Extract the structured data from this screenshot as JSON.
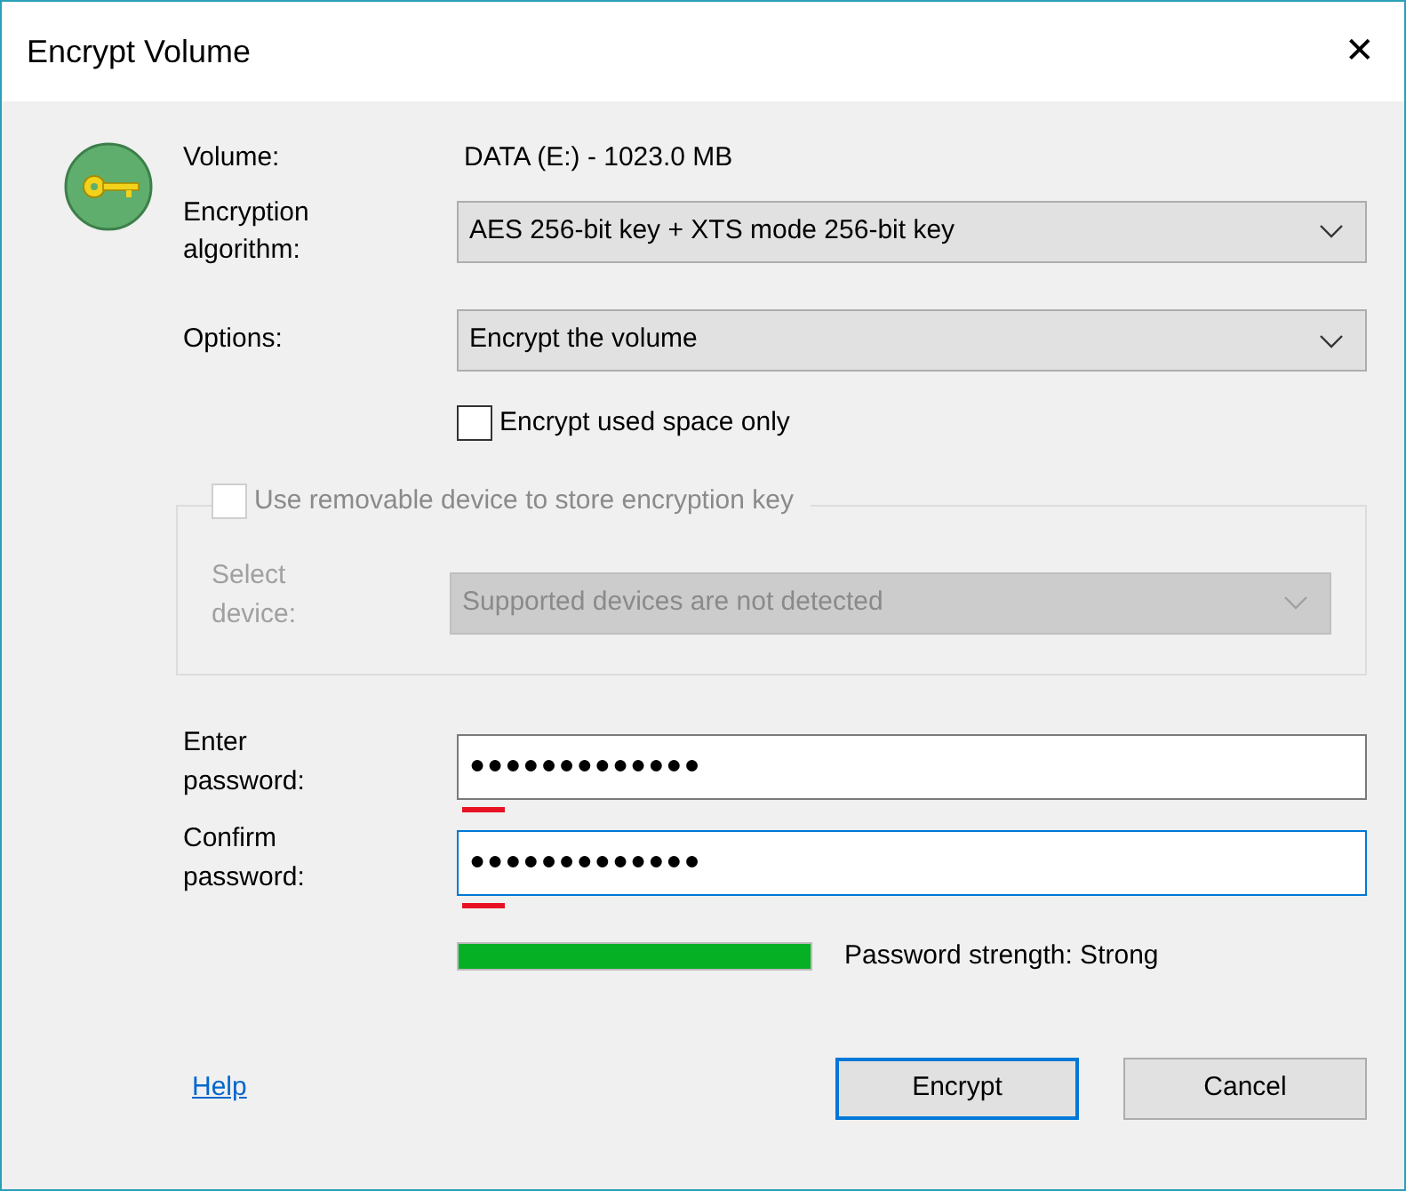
{
  "window": {
    "title": "Encrypt Volume",
    "close": "✕"
  },
  "volume": {
    "label": "Volume:",
    "value": "DATA (E:) - 1023.0 MB"
  },
  "algorithm": {
    "label": "Encryption algorithm:",
    "value": "AES 256-bit key + XTS mode 256-bit key"
  },
  "options": {
    "label": "Options:",
    "value": "Encrypt the volume"
  },
  "used_space_only": {
    "label": "Encrypt used space only",
    "checked": false
  },
  "removable_device": {
    "label": "Use removable device to store encryption key",
    "checked": false,
    "disabled": true,
    "select_label": "Select device:",
    "select_value": "Supported devices are not detected"
  },
  "password": {
    "label": "Enter password:",
    "value": "●●●●●●●●●●●●●",
    "focused": false
  },
  "confirm": {
    "label": "Confirm password:",
    "value": "●●●●●●●●●●●●●",
    "focused": true
  },
  "strength": {
    "level": 1,
    "label": "Password strength: Strong"
  },
  "help": "Help",
  "buttons": [
    {
      "label": "Encrypt",
      "default": true
    },
    {
      "label": "Cancel",
      "default": false
    }
  ]
}
